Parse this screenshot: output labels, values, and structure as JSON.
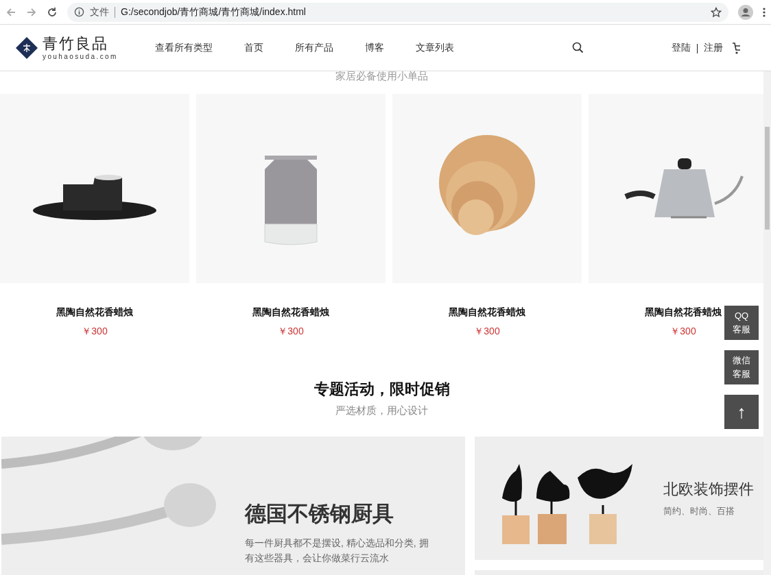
{
  "browser": {
    "address_label": "文件",
    "url": "G:/secondjob/青竹商城/青竹商城/index.html"
  },
  "header": {
    "logo": {
      "name": "青竹良品",
      "domain": "youhaosuda.com"
    },
    "nav": [
      "查看所有类型",
      "首页",
      "所有产品",
      "博客",
      "文章列表"
    ],
    "login": "登陆",
    "separator": "|",
    "register": "注册"
  },
  "products_section": {
    "subtitle": "家居必备使用小单品",
    "products": [
      {
        "kind": "candle",
        "name": "黑陶自然花香蜡烛",
        "price": "￥300"
      },
      {
        "kind": "vase",
        "name": "黑陶自然花香蜡烛",
        "price": "￥300"
      },
      {
        "kind": "plates",
        "name": "黑陶自然花香蜡烛",
        "price": "￥300"
      },
      {
        "kind": "kettle",
        "name": "黑陶自然花香蜡烛",
        "price": "￥300"
      }
    ]
  },
  "promo_section": {
    "title": "专题活动，限时促销",
    "subtitle": "严选材质，用心设计",
    "promos": [
      {
        "kind": "large",
        "title": "德国不锈钢厨具",
        "description": "每一件厨具都不是摆设, 精心选品和分类, 拥有这些器具，会让你做菜行云流水"
      },
      {
        "kind": "small",
        "title": "北欧装饰摆件",
        "description": "简约、时尚、百搭"
      }
    ]
  },
  "float_tools": [
    {
      "kind": "text",
      "lines": [
        "QQ",
        "客服"
      ]
    },
    {
      "kind": "text",
      "lines": [
        "微信",
        "客服"
      ]
    },
    {
      "kind": "arrow",
      "symbol": "↑"
    }
  ]
}
